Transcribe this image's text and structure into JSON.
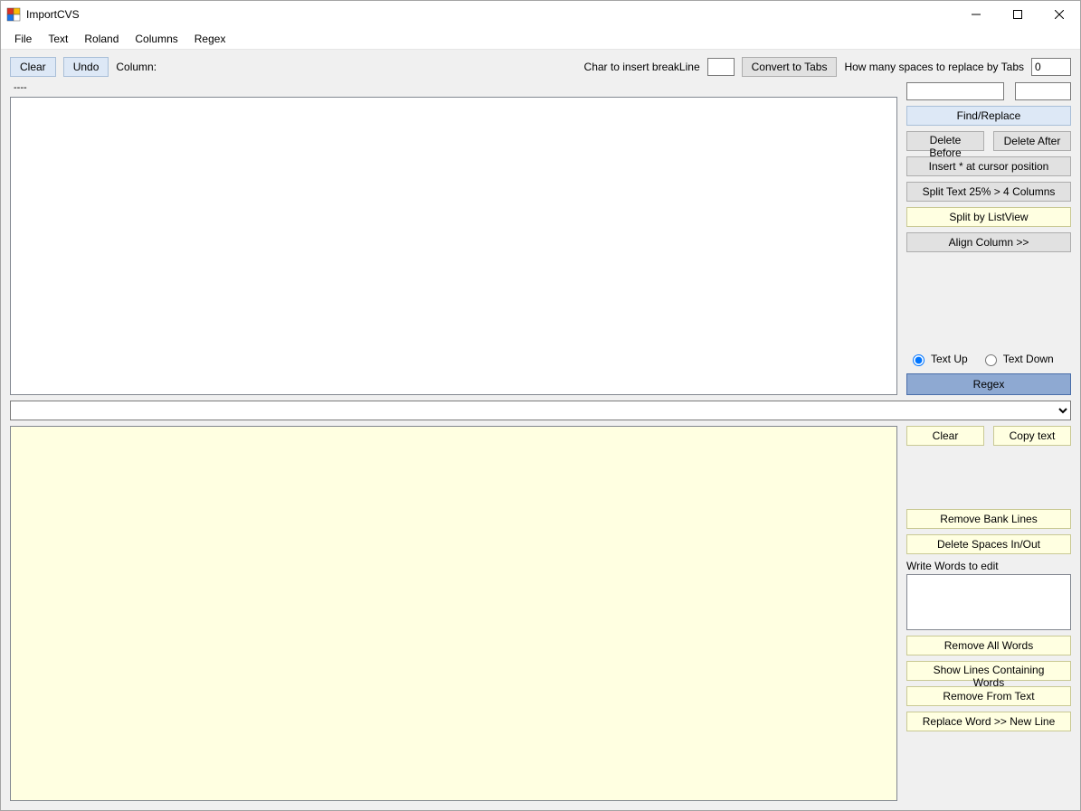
{
  "window": {
    "title": "ImportCVS"
  },
  "menu": {
    "file": "File",
    "text": "Text",
    "roland": "Roland",
    "columns": "Columns",
    "regex": "Regex"
  },
  "toolbar": {
    "clear": "Clear",
    "undo": "Undo",
    "column_label": "Column:",
    "char_break_label": "Char to insert breakLine",
    "char_break_value": "",
    "convert_tabs": "Convert to Tabs",
    "spaces_label": "How many spaces to replace by Tabs",
    "spaces_value": "0",
    "dash": "----"
  },
  "upper": {
    "text": ""
  },
  "side_upper": {
    "find_value": "",
    "replace_value": "",
    "find_replace": "Find/Replace",
    "delete_before": "Delete Before",
    "delete_after": "Delete After",
    "insert_star": "Insert  *  at cursor position",
    "split_25": "Split Text 25% > 4 Columns",
    "split_listview": "Split by ListView",
    "align_column": "Align Column >>",
    "text_up": "Text Up",
    "text_down": "Text Down",
    "regex": "Regex"
  },
  "combo": {
    "value": ""
  },
  "lower": {
    "text": ""
  },
  "side_lower": {
    "clear": "Clear",
    "copy": "Copy text",
    "remove_blank": "Remove Bank Lines",
    "delete_spaces": "Delete Spaces In/Out",
    "words_label": "Write Words to edit",
    "words_value": "",
    "remove_all_words": "Remove All Words",
    "show_lines": "Show Lines Containing Words",
    "remove_from_text": "Remove From Text",
    "replace_newline": "Replace Word >> New Line"
  }
}
